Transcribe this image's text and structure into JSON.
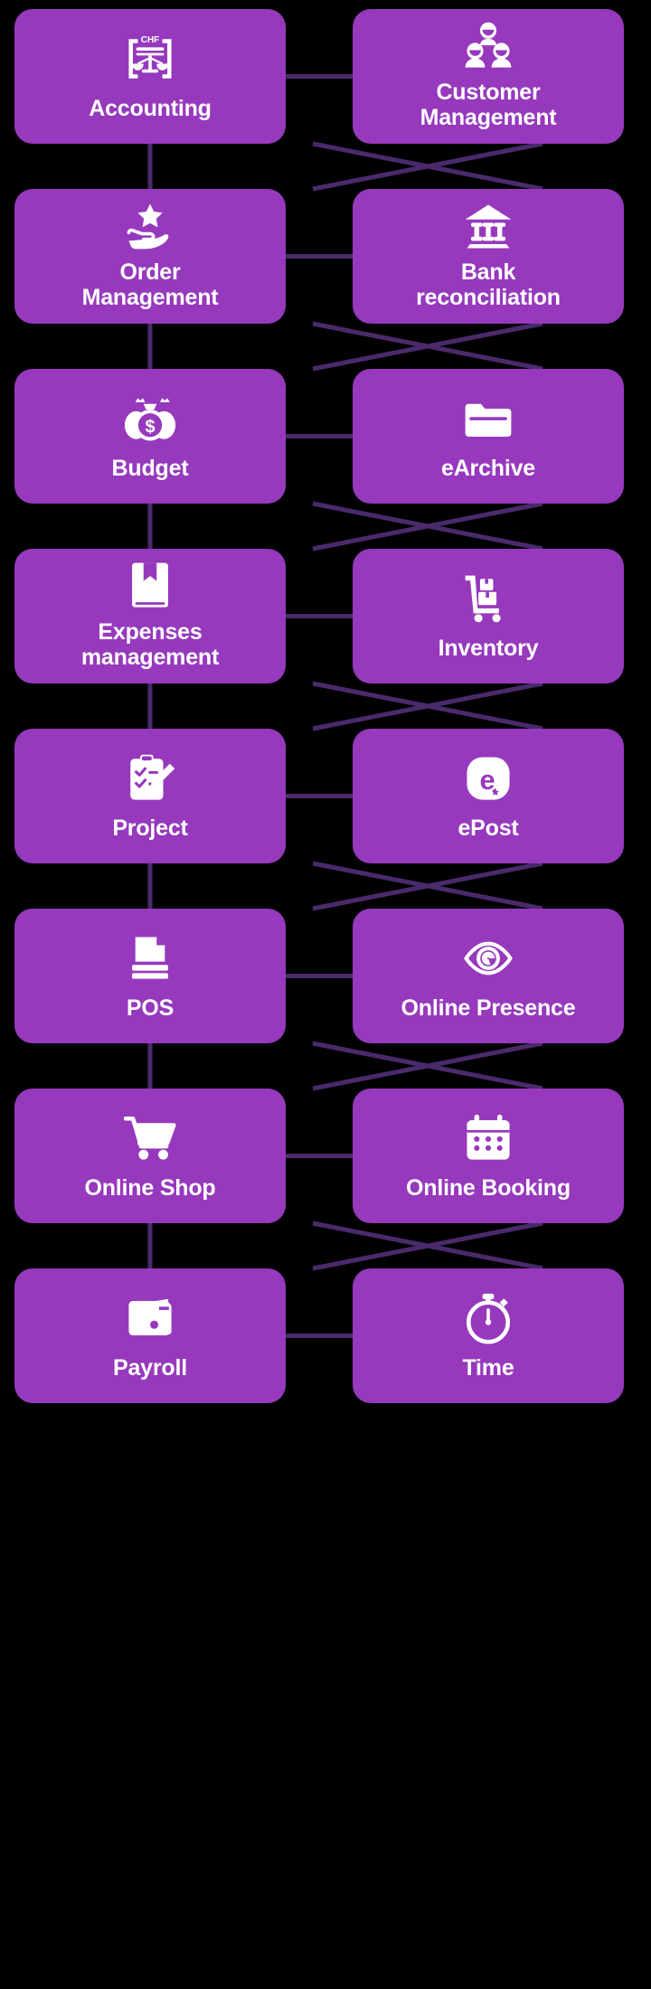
{
  "diagram": {
    "title": "Business modules diagram",
    "background_color": "#000000",
    "card_color": "#9639bd",
    "card_text_color": "#ffffff",
    "connector_color": "#4a2a6b",
    "columns": 2,
    "rows": 8
  },
  "cards": [
    {
      "id": "accounting",
      "label": "Accounting",
      "icon": "chf-document-scales-icon",
      "column": "left",
      "row": 1
    },
    {
      "id": "customer-management",
      "label": "Customer\nManagement",
      "icon": "three-people-group-icon",
      "column": "right",
      "row": 1
    },
    {
      "id": "order-management",
      "label": "Order\nManagement",
      "icon": "hand-star-icon",
      "column": "left",
      "row": 2
    },
    {
      "id": "bank-reconciliation",
      "label": "Bank\nreconciliation",
      "icon": "bank-building-icon",
      "column": "right",
      "row": 2
    },
    {
      "id": "budget",
      "label": "Budget",
      "icon": "money-bags-dollar-icon",
      "column": "left",
      "row": 3
    },
    {
      "id": "earchive",
      "label": "eArchive",
      "icon": "open-folder-icon",
      "column": "right",
      "row": 3
    },
    {
      "id": "expenses-management",
      "label": "Expenses\nmanagement",
      "icon": "bookmark-book-icon",
      "column": "left",
      "row": 4
    },
    {
      "id": "inventory",
      "label": "Inventory",
      "icon": "hand-truck-boxes-icon",
      "column": "right",
      "row": 4
    },
    {
      "id": "project",
      "label": "Project",
      "icon": "clipboard-pencil-icon",
      "column": "left",
      "row": 5
    },
    {
      "id": "epost",
      "label": "ePost",
      "icon": "epost-logo-icon",
      "column": "right",
      "row": 5
    },
    {
      "id": "pos",
      "label": "POS",
      "icon": "receipt-printer-icon",
      "column": "left",
      "row": 6
    },
    {
      "id": "online-presence",
      "label": "Online Presence",
      "icon": "eye-spiral-icon",
      "column": "right",
      "row": 6
    },
    {
      "id": "online-shop",
      "label": "Online Shop",
      "icon": "shopping-cart-icon",
      "column": "left",
      "row": 7
    },
    {
      "id": "online-booking",
      "label": "Online Booking",
      "icon": "calendar-dots-icon",
      "column": "right",
      "row": 7
    },
    {
      "id": "payroll",
      "label": "Payroll",
      "icon": "wallet-icon",
      "column": "left",
      "row": 8
    },
    {
      "id": "time",
      "label": "Time",
      "icon": "stopwatch-icon",
      "column": "right",
      "row": 8
    }
  ],
  "icon_labels": {
    "chf-document-scales-icon": "CHF"
  }
}
